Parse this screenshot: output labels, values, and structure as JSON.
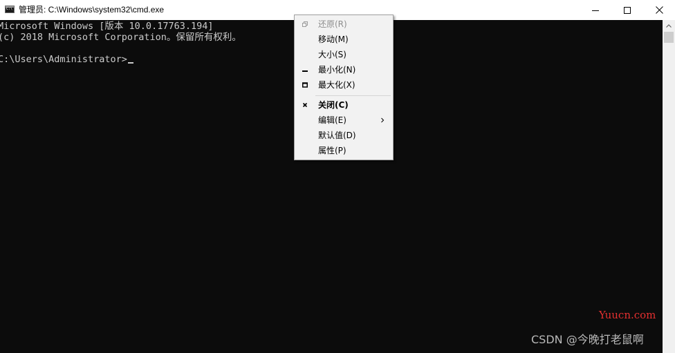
{
  "titlebar": {
    "title": "管理员: C:\\Windows\\system32\\cmd.exe",
    "icon": "cmd-console-icon",
    "controls": [
      "minimize",
      "maximize",
      "close"
    ]
  },
  "console": {
    "lines": [
      "Microsoft Windows [版本 10.0.17763.194]",
      "(c) 2018 Microsoft Corporation。保留所有权利。",
      "C:\\Users\\Administrator>"
    ],
    "text_color": "#cccccc",
    "background": "#0c0c0c"
  },
  "context_menu": {
    "items": [
      {
        "label": "还原(R)",
        "icon": "restore-icon",
        "disabled": true
      },
      {
        "label": "移动(M)"
      },
      {
        "label": "大小(S)"
      },
      {
        "label": "最小化(N)",
        "icon": "minimize-icon"
      },
      {
        "label": "最大化(X)",
        "icon": "maximize-icon"
      },
      {
        "label": "关闭(C)",
        "icon": "close-icon",
        "bold": true
      },
      {
        "label": "编辑(E)",
        "submenu": true
      },
      {
        "label": "默认值(D)"
      },
      {
        "label": "属性(P)"
      }
    ]
  },
  "watermarks": {
    "site": "Yuucn.com",
    "author": "CSDN @今晚打老鼠啊"
  },
  "colors": {
    "watermark_site": "#e53030",
    "menu_background": "#f2f2f2",
    "disabled_text": "#8d8d8d"
  }
}
